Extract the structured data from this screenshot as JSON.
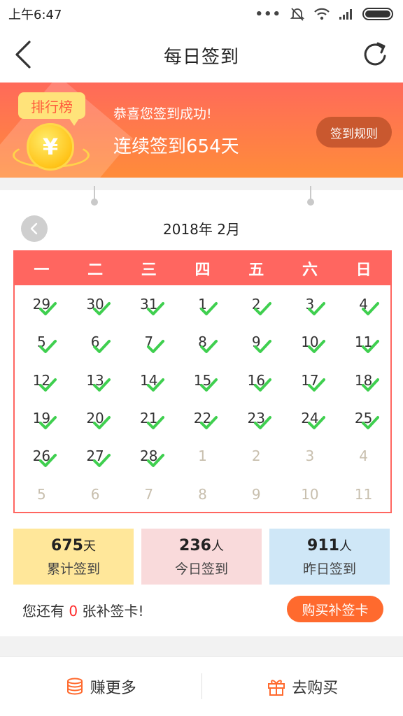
{
  "status_bar": {
    "time": "上午6:47"
  },
  "header": {
    "title": "每日签到"
  },
  "banner": {
    "rank_badge": "排行榜",
    "coin_symbol": "¥",
    "success_text": "恭喜您签到成功!",
    "streak_text": "连续签到654天",
    "rules_button": "签到规则"
  },
  "calendar": {
    "month_label": "2018年 2月",
    "weekdays": [
      "一",
      "二",
      "三",
      "四",
      "五",
      "六",
      "日"
    ],
    "days": [
      {
        "n": "29",
        "c": true,
        "o": false
      },
      {
        "n": "30",
        "c": true,
        "o": false
      },
      {
        "n": "31",
        "c": true,
        "o": false
      },
      {
        "n": "1",
        "c": true,
        "o": false
      },
      {
        "n": "2",
        "c": true,
        "o": false
      },
      {
        "n": "3",
        "c": true,
        "o": false
      },
      {
        "n": "4",
        "c": true,
        "o": false
      },
      {
        "n": "5",
        "c": true,
        "o": false
      },
      {
        "n": "6",
        "c": true,
        "o": false
      },
      {
        "n": "7",
        "c": true,
        "o": false
      },
      {
        "n": "8",
        "c": true,
        "o": false
      },
      {
        "n": "9",
        "c": true,
        "o": false
      },
      {
        "n": "10",
        "c": true,
        "o": false
      },
      {
        "n": "11",
        "c": true,
        "o": false
      },
      {
        "n": "12",
        "c": true,
        "o": false
      },
      {
        "n": "13",
        "c": true,
        "o": false
      },
      {
        "n": "14",
        "c": true,
        "o": false
      },
      {
        "n": "15",
        "c": true,
        "o": false
      },
      {
        "n": "16",
        "c": true,
        "o": false
      },
      {
        "n": "17",
        "c": true,
        "o": false
      },
      {
        "n": "18",
        "c": true,
        "o": false
      },
      {
        "n": "19",
        "c": true,
        "o": false
      },
      {
        "n": "20",
        "c": true,
        "o": false
      },
      {
        "n": "21",
        "c": true,
        "o": false
      },
      {
        "n": "22",
        "c": true,
        "o": false
      },
      {
        "n": "23",
        "c": true,
        "o": false
      },
      {
        "n": "24",
        "c": true,
        "o": false
      },
      {
        "n": "25",
        "c": true,
        "o": false
      },
      {
        "n": "26",
        "c": true,
        "o": false
      },
      {
        "n": "27",
        "c": true,
        "o": false
      },
      {
        "n": "28",
        "c": true,
        "o": false
      },
      {
        "n": "1",
        "c": false,
        "o": true
      },
      {
        "n": "2",
        "c": false,
        "o": true
      },
      {
        "n": "3",
        "c": false,
        "o": true
      },
      {
        "n": "4",
        "c": false,
        "o": true
      },
      {
        "n": "5",
        "c": false,
        "o": true
      },
      {
        "n": "6",
        "c": false,
        "o": true
      },
      {
        "n": "7",
        "c": false,
        "o": true
      },
      {
        "n": "8",
        "c": false,
        "o": true
      },
      {
        "n": "9",
        "c": false,
        "o": true
      },
      {
        "n": "10",
        "c": false,
        "o": true
      },
      {
        "n": "11",
        "c": false,
        "o": true
      }
    ]
  },
  "stats": [
    {
      "value": "675",
      "unit": "天",
      "label": "累计签到"
    },
    {
      "value": "236",
      "unit": "人",
      "label": "今日签到"
    },
    {
      "value": "911",
      "unit": "人",
      "label": "昨日签到"
    }
  ],
  "makeup_cards": {
    "prefix": "您还有 ",
    "count": "0",
    "suffix": " 张补签卡!",
    "buy_button": "购买补签卡"
  },
  "bottom_bar": {
    "earn_more": "赚更多",
    "go_buy": "去购买"
  },
  "colors": {
    "accent": "#ff6660",
    "check": "#3fcf4f",
    "button_orange": "#ff6a2e"
  }
}
